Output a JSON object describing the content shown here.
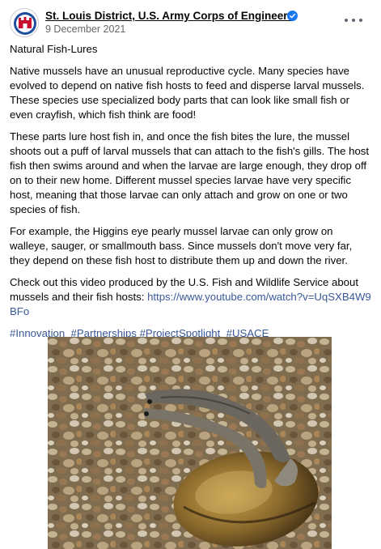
{
  "header": {
    "page_name": "St. Louis District, U.S. Army Corps of Engineers",
    "timestamp": "9 December 2021",
    "verified_icon": "verified-badge-icon",
    "more_icon": "more-options-icon"
  },
  "post": {
    "title": "Natural Fish-Lures",
    "paragraphs": [
      "Native mussels have an unusual reproductive cycle. Many species have evolved to depend on native fish hosts to feed and disperse larval mussels. These species use specialized body parts that can look like small fish or even crayfish, which fish think are food!",
      "These parts lure host fish in, and once the fish bites the lure, the mussel shoots out a puff of larval mussels that can attach to the fish's gills. The host fish then swims around and when the larvae are large enough, they drop off on to their new home. Different mussel species larvae have very specific host, meaning that those larvae can only attach and grow on one or two species of fish.",
      "For example, the Higgins eye pearly mussel larvae can only grow on walleye, sauger, or smallmouth bass. Since mussels don't move very far, they depend on these fish host to distribute them up and down the river."
    ],
    "video_text": "Check out this video produced by the U.S. Fish and Wildlife Service about mussels and their fish hosts:",
    "video_link": "https://www.youtube.com/watch?v=UqSXB4W9BFo",
    "hashtags": [
      "#Innovation",
      "#Partnerships",
      "#ProjectSpotlight",
      "#USACE"
    ]
  },
  "colors": {
    "link": "#385898",
    "secondary_text": "#65676b",
    "verified": "#1877f2"
  }
}
